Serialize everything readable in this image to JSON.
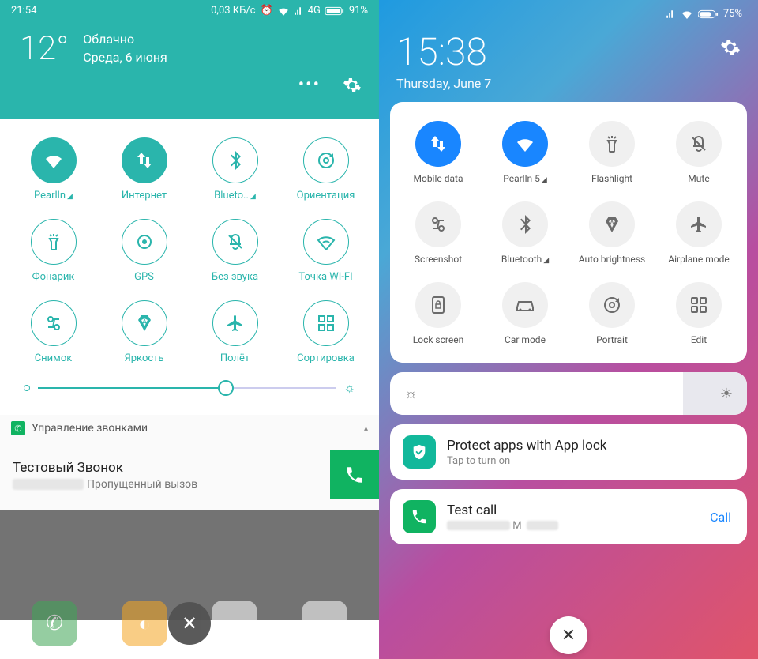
{
  "left": {
    "status": {
      "time": "21:54",
      "speed": "0,03 КБ/с",
      "net": "4G",
      "battery": "91%"
    },
    "weather": {
      "temp": "12°",
      "cond": "Облачно",
      "date": "Среда, 6 июня"
    },
    "tiles": [
      {
        "label": "Pearlln",
        "icon": "wifi",
        "active": true,
        "caret": true
      },
      {
        "label": "Интернет",
        "icon": "data",
        "active": true
      },
      {
        "label": "Blueto..",
        "icon": "bluetooth",
        "active": false,
        "caret": true
      },
      {
        "label": "Ориентация",
        "icon": "rotation",
        "active": false
      },
      {
        "label": "Фонарик",
        "icon": "flashlight",
        "active": false
      },
      {
        "label": "GPS",
        "icon": "gps",
        "active": false
      },
      {
        "label": "Без звука",
        "icon": "mute",
        "active": false
      },
      {
        "label": "Точка WI-FI",
        "icon": "hotspot",
        "active": false
      },
      {
        "label": "Снимок",
        "icon": "screenshot",
        "active": false
      },
      {
        "label": "Яркость",
        "icon": "brightness",
        "active": false
      },
      {
        "label": "Полёт",
        "icon": "airplane",
        "active": false
      },
      {
        "label": "Сортировка",
        "icon": "sort",
        "active": false
      }
    ],
    "notif": {
      "head": "Управление звонками",
      "title": "Тестовый Звонок",
      "sub": "Пропущенный вызов"
    }
  },
  "right": {
    "status": {
      "battery": "75%"
    },
    "clock": "15:38",
    "date": "Thursday, June 7",
    "tiles": [
      {
        "label": "Mobile data",
        "icon": "data",
        "active": true
      },
      {
        "label": "Pearlln 5",
        "icon": "wifi",
        "active": true,
        "caret": true
      },
      {
        "label": "Flashlight",
        "icon": "flashlight",
        "active": false
      },
      {
        "label": "Mute",
        "icon": "mute",
        "active": false
      },
      {
        "label": "Screenshot",
        "icon": "screenshot",
        "active": false
      },
      {
        "label": "Bluetooth",
        "icon": "bluetooth",
        "active": false,
        "caret": true
      },
      {
        "label": "Auto brightness",
        "icon": "brightness",
        "active": false
      },
      {
        "label": "Airplane mode",
        "icon": "airplane",
        "active": false
      },
      {
        "label": "Lock screen",
        "icon": "lock",
        "active": false
      },
      {
        "label": "Car mode",
        "icon": "car",
        "active": false
      },
      {
        "label": "Portrait",
        "icon": "rotation",
        "active": false
      },
      {
        "label": "Edit",
        "icon": "edit",
        "active": false
      }
    ],
    "notif1": {
      "title": "Protect apps with App lock",
      "sub": "Tap to turn on"
    },
    "notif2": {
      "title": "Test call",
      "sub": "M",
      "action": "Call"
    }
  }
}
